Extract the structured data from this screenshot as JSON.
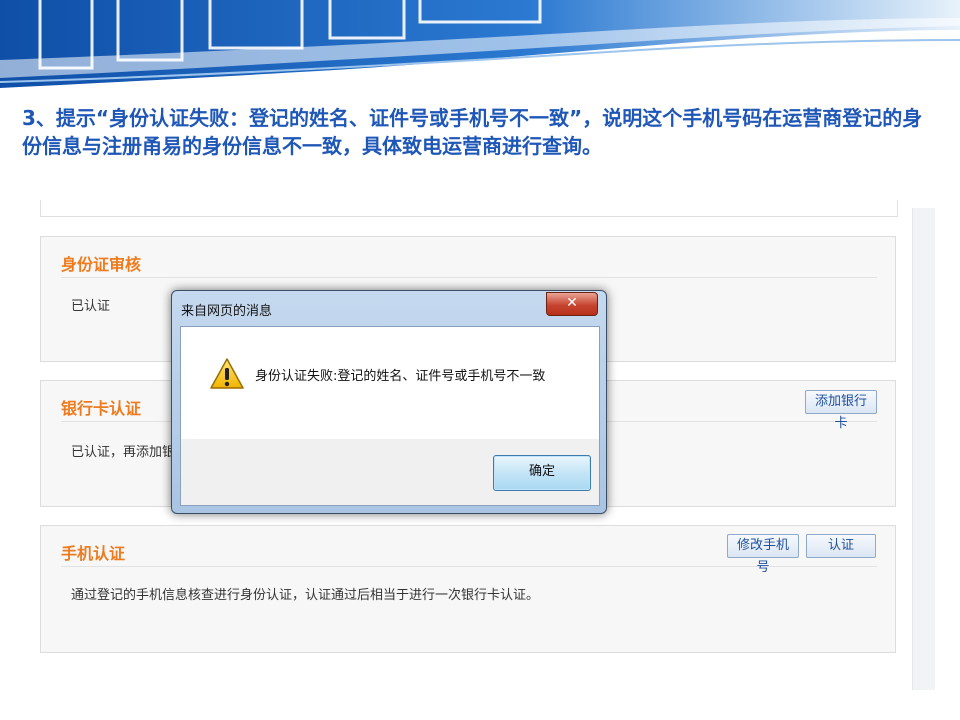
{
  "slide": {
    "caption": "3、提示“身份认证失败：登记的姓名、证件号或手机号不一致”，说明这个手机号码在运营商登记的身份信息与注册甬易的身份信息不一致，具体致电运营商进行查询。"
  },
  "page": {
    "id_card": {
      "title": "身份证审核",
      "status": "已认证"
    },
    "bank_card": {
      "title": "银行卡认证",
      "status": "已认证，再添加银",
      "add_button": "添加银行卡"
    },
    "phone": {
      "title": "手机认证",
      "description": "通过登记的手机信息核查进行身份认证，认证通过后相当于进行一次银行卡认证。",
      "modify_button": "修改手机号",
      "verify_button": "认证"
    }
  },
  "dialog": {
    "title": "来自网页的消息",
    "close_glyph": "✕",
    "icon": "warning-icon",
    "message": "身份认证失败:登记的姓名、证件号或手机号不一致",
    "ok_button": "确定"
  },
  "colors": {
    "caption": "#1f57b7",
    "section_title": "#ee7b1d",
    "banner_blue": "#1a63b8"
  }
}
